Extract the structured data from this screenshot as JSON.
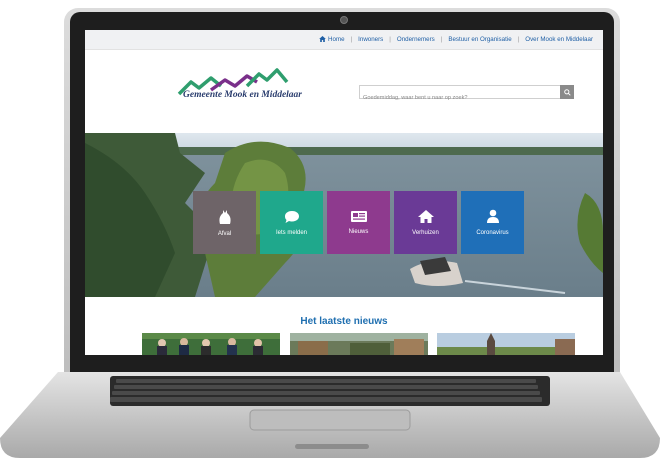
{
  "topnav": {
    "home": "Home",
    "inwoners": "Inwoners",
    "ondernemers": "Ondernemers",
    "bestuur": "Bestuur en Organisatie",
    "over": "Over Mook en Middelaar"
  },
  "logo": {
    "text": "Gemeente Mook en Middelaar"
  },
  "search": {
    "placeholder": "Goedemiddag, waar bent u naar op zoek?"
  },
  "tiles": [
    {
      "label": "Afval",
      "color": "#6e6468"
    },
    {
      "label": "Iets melden",
      "color": "#1fa88c"
    },
    {
      "label": "Nieuws",
      "color": "#8e3a8e"
    },
    {
      "label": "Verhuizen",
      "color": "#6a3a96"
    },
    {
      "label": "Coronavirus",
      "color": "#1f6fb8"
    }
  ],
  "news": {
    "title": "Het laatste nieuws"
  }
}
